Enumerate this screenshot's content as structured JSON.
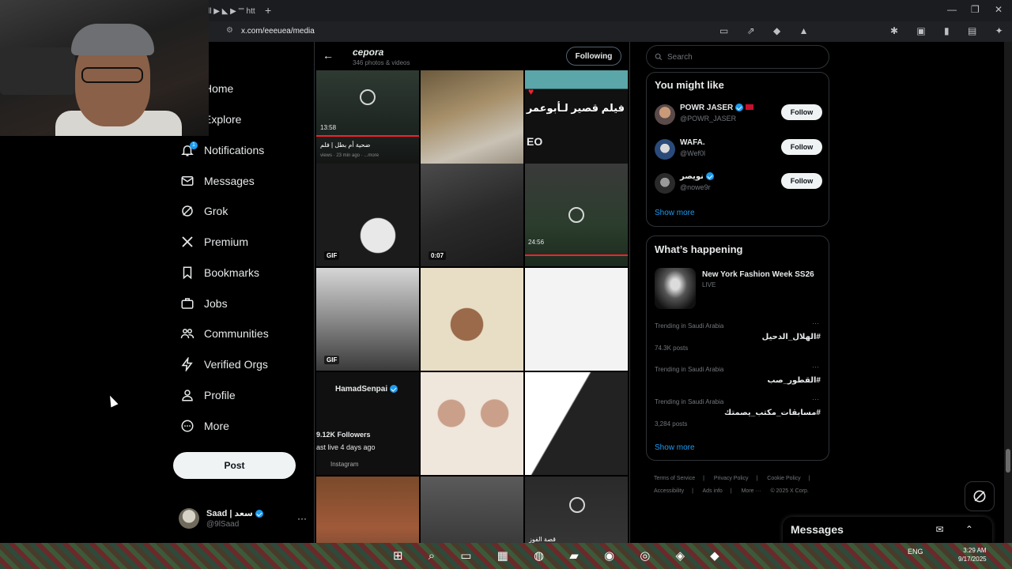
{
  "browser": {
    "tab_label": "ll ▶ ◣ ▶ \"\" htt",
    "new_tab": "+",
    "url": "x.com/eeeuea/media",
    "minimize": "—",
    "restore": "❐",
    "close": "✕"
  },
  "nav": {
    "items": [
      {
        "label": "Home",
        "icon": "home-icon"
      },
      {
        "label": "Explore",
        "icon": "search-icon"
      },
      {
        "label": "Notifications",
        "icon": "bell-icon",
        "badge": "1"
      },
      {
        "label": "Messages",
        "icon": "mail-icon"
      },
      {
        "label": "Grok",
        "icon": "grok-icon"
      },
      {
        "label": "Premium",
        "icon": "x-logo-icon"
      },
      {
        "label": "Bookmarks",
        "icon": "bookmark-icon"
      },
      {
        "label": "Jobs",
        "icon": "briefcase-icon"
      },
      {
        "label": "Communities",
        "icon": "people-icon"
      },
      {
        "label": "Verified Orgs",
        "icon": "lightning-icon"
      },
      {
        "label": "Profile",
        "icon": "person-icon"
      },
      {
        "label": "More",
        "icon": "more-circle-icon"
      }
    ],
    "post_label": "Post",
    "account": {
      "name": "Saad | سعد",
      "handle": "@9lSaad",
      "more": "···"
    }
  },
  "profile": {
    "name": "cepora",
    "subtitle": "346 photos & videos",
    "following_label": "Following",
    "back": "←"
  },
  "tiles": {
    "t1_caption": "ضحية أم بطل | فلم",
    "t1_meta": "views · 23 min ago · ...more",
    "t1_time": "13:58",
    "t3_text": "فيلم قصير لـأبوعمر",
    "t3_sub": "EO",
    "t4_label": "GIF",
    "t5_time": "0:07",
    "t6_time": "24:56",
    "t7_label": "GIF",
    "t10_name": "HamadSenpai",
    "t10_followers": "9.12K Followers",
    "t10_live": "ast live 4 days ago",
    "t10_source": "Instagram",
    "t12_caption": "قصة الفوز"
  },
  "right": {
    "search_placeholder": "Search",
    "wtf_title": "You might like",
    "wtf": [
      {
        "name": "POWR JASER",
        "handle": "@POWR_JASER",
        "follow": "Follow"
      },
      {
        "name": "WAFA.",
        "handle": "@Wef0l",
        "follow": "Follow"
      },
      {
        "name": "نويصر",
        "handle": "@nowe9r",
        "follow": "Follow"
      }
    ],
    "show_more_1": "Show more",
    "happening_title": "What’s happening",
    "event": {
      "title": "New York Fashion Week SS26",
      "status": "LIVE"
    },
    "trends": [
      {
        "context": "Trending in Saudi Arabia",
        "name": "#الهلال_الدحيل",
        "count": "74.3K posts"
      },
      {
        "context": "Trending in Saudi Arabia",
        "name": "#القطور_صب",
        "count": ""
      },
      {
        "context": "Trending in Saudi Arabia",
        "name": "#مسابقات_مكتب_يصمتك",
        "count": "3,284 posts"
      }
    ],
    "trend_more": "···",
    "show_more_2": "Show more",
    "footer": [
      "Terms of Service",
      "|",
      "Privacy Policy",
      "|",
      "Cookie Policy",
      "|",
      "Accessibility",
      "|",
      "Ads info",
      "|",
      "More ···",
      "© 2025 X Corp."
    ]
  },
  "messages_drawer": {
    "title": "Messages",
    "icons": "✉ ⌃"
  },
  "taskbar": {
    "apps": "⊞ ⌕ ▭ ▦ ◍ ▰ ◉ ◎ ◈ ◆",
    "tray": "ENG",
    "time": "3:29 AM",
    "date": "9/17/2025"
  }
}
